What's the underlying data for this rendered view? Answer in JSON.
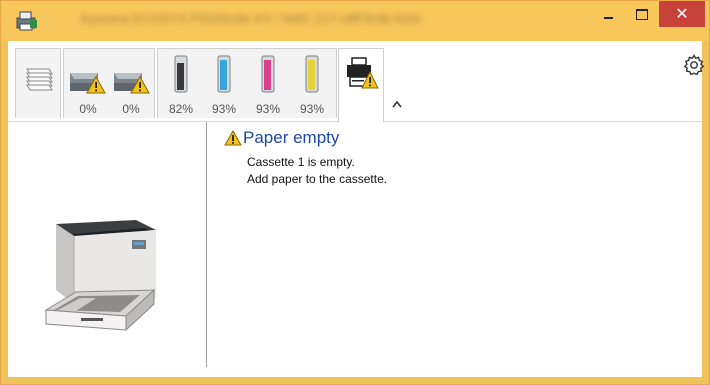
{
  "window": {
    "title": "Kyocera ECOSYS P5026cdw KX / fe80::217:c8ff:fe3b:410c",
    "controls": {
      "minimize": "–",
      "maximize": "□",
      "close": "✕"
    },
    "title_bar_color": "#f7c75c",
    "close_color": "#c7423b"
  },
  "status_tabs": {
    "paper": {
      "icon": "paper-stack-icon"
    },
    "trays": [
      {
        "icon": "empty-tray-warning-icon",
        "level": "0%"
      },
      {
        "icon": "empty-tray-warning-icon",
        "level": "0%"
      }
    ],
    "toners": [
      {
        "color": "black",
        "hex": "#3a3a3a",
        "level": "82%"
      },
      {
        "color": "cyan",
        "hex": "#3aa3d8",
        "level": "93%"
      },
      {
        "color": "magenta",
        "hex": "#d9418f",
        "level": "93%"
      },
      {
        "color": "yellow",
        "hex": "#e6d23a",
        "level": "93%"
      }
    ],
    "device": {
      "icon": "printer-warning-icon",
      "selected": true
    },
    "collapse_icon": "collapse-up-icon",
    "settings_icon": "gear-icon"
  },
  "message": {
    "icon": "warning-icon",
    "title": "Paper empty",
    "lines": [
      "Cassette 1 is empty.",
      "Add paper to the cassette."
    ]
  },
  "preview": {
    "image": "printer-open-cassette-image"
  }
}
